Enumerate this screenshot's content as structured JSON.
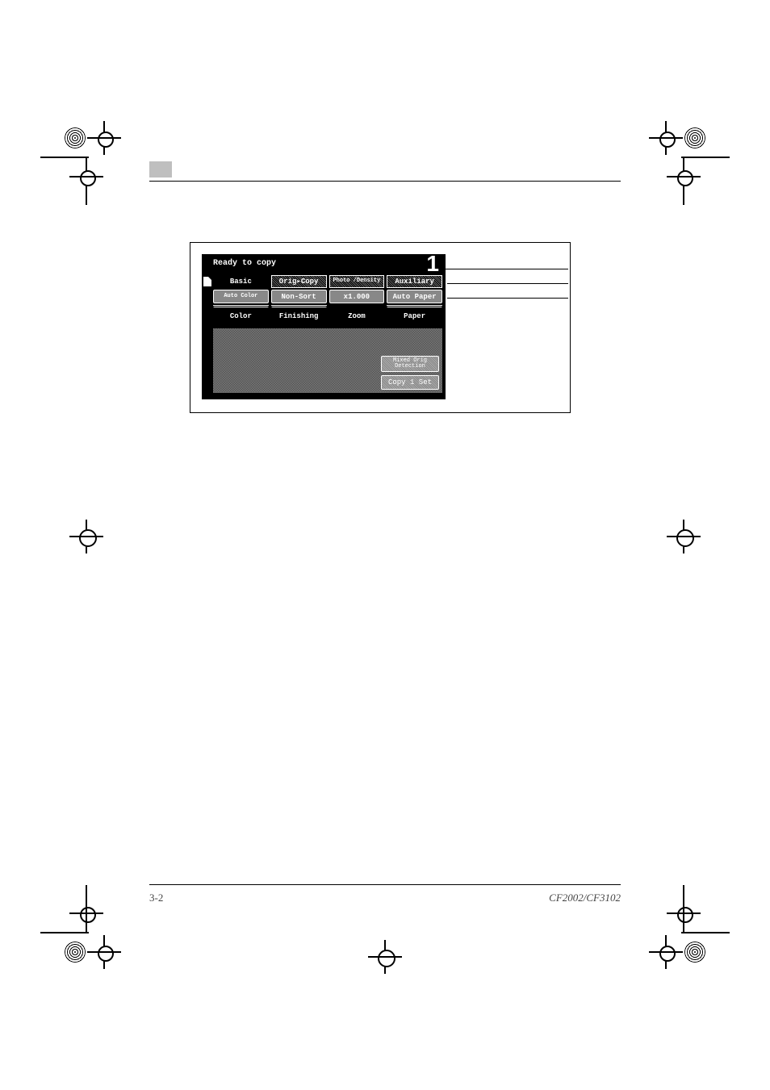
{
  "footer": {
    "page_number": "3-2",
    "product": "CF2002/CF3102"
  },
  "lcd": {
    "status": "Ready to copy",
    "count_display": "1",
    "tabs": [
      "Basic",
      "Orig▸Copy",
      "Photo\n/Density",
      "Auxiliary"
    ],
    "active_tab_index": 0,
    "value_buttons": [
      "Auto\nColor",
      "Non-Sort",
      "x1.000",
      "Auto Paper"
    ],
    "underbar_visible": [
      true,
      true,
      false,
      true
    ],
    "categories": [
      "Color",
      "Finishing",
      "Zoom",
      "Paper"
    ],
    "side_buttons": {
      "mixed": "Mixed Orig\nDetection",
      "copy1": "Copy 1 Set"
    }
  }
}
